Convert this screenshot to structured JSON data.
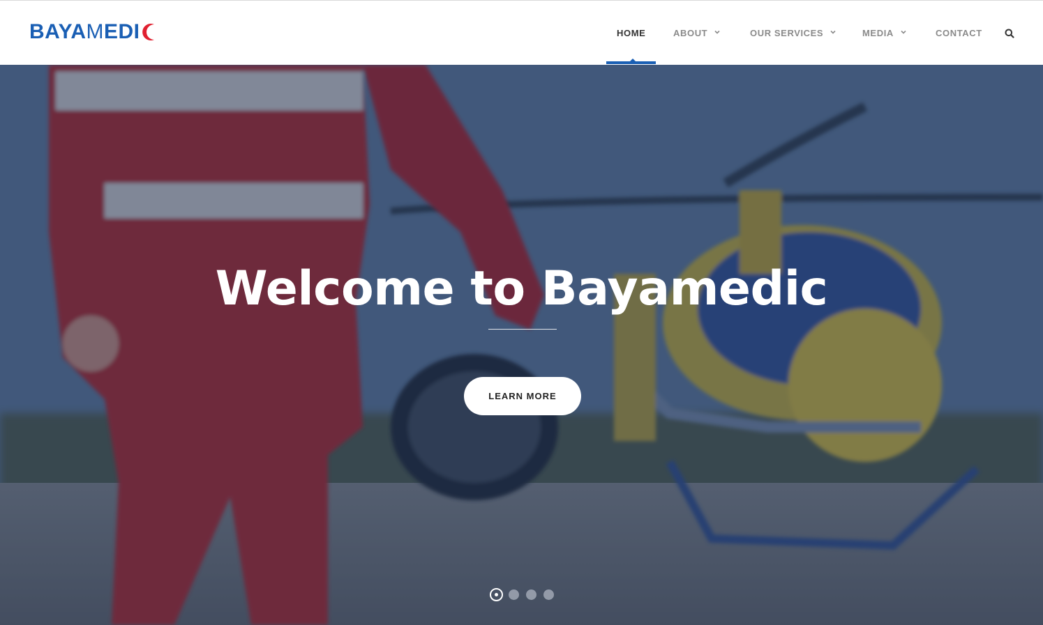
{
  "brand": {
    "logo_bold": "BAYA",
    "logo_thin": "M",
    "logo_bold2": "EDI",
    "logo_color": "#1a5fb4",
    "crescent_color": "#e02030"
  },
  "nav": {
    "items": [
      {
        "label": "HOME",
        "has_dropdown": false,
        "active": true
      },
      {
        "label": "ABOUT",
        "has_dropdown": true
      },
      {
        "label": "OUR SERVICES",
        "has_dropdown": true
      },
      {
        "label": "MEDIA",
        "has_dropdown": true
      },
      {
        "label": "CONTACT",
        "has_dropdown": false
      }
    ],
    "search_icon": "search-icon",
    "accent_color": "#1a5fb4"
  },
  "hero": {
    "title": "Welcome to Bayamedic",
    "cta_label": "LEARN MORE",
    "slider": {
      "total": 4,
      "current": 1
    },
    "overlay_color": "#1e3056"
  }
}
